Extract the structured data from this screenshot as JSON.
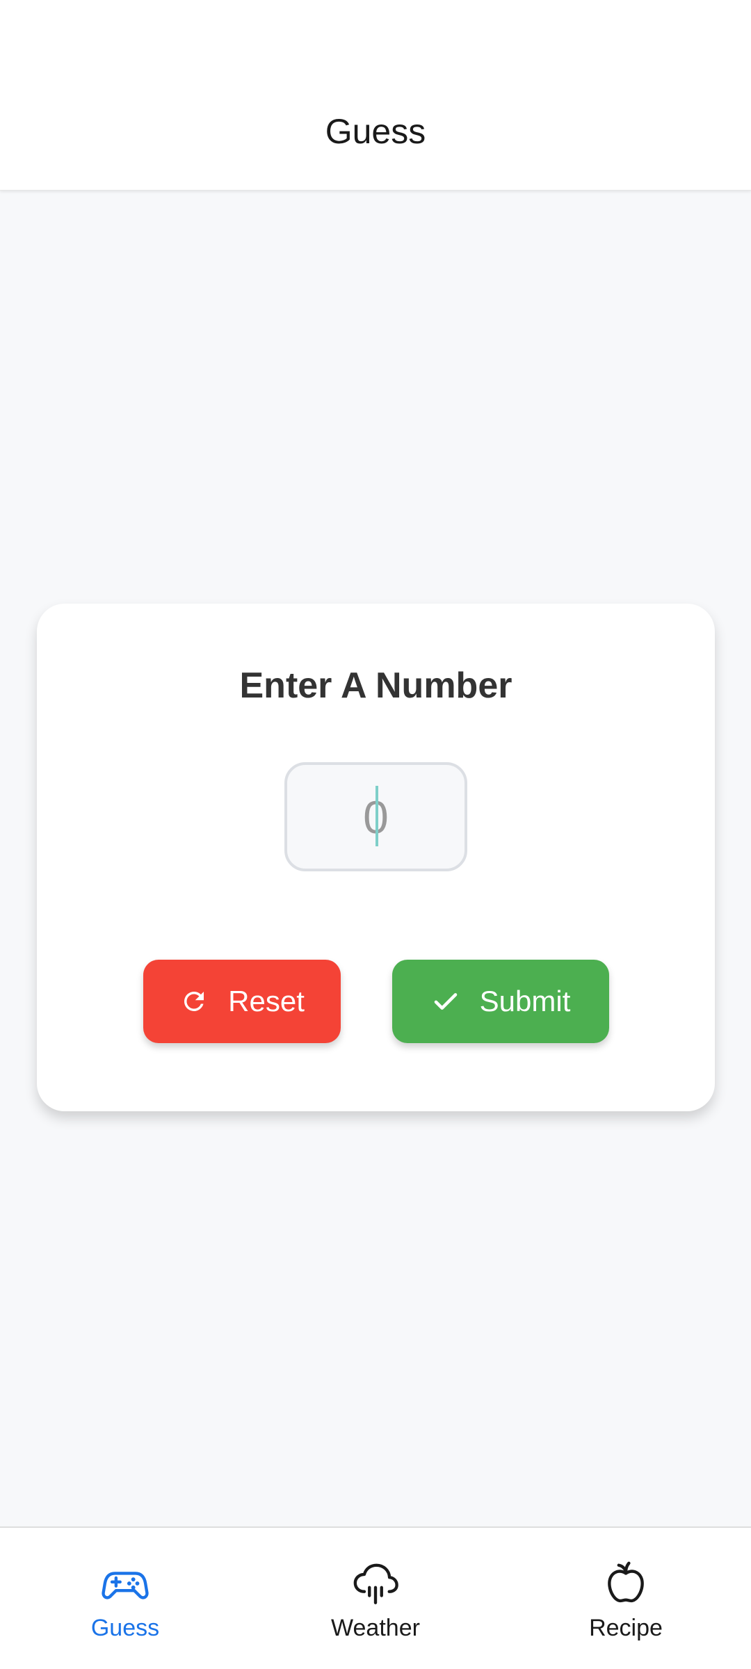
{
  "header": {
    "title": "Guess"
  },
  "card": {
    "title": "Enter A Number",
    "input": {
      "value": "",
      "placeholder": "0"
    },
    "reset_label": "Reset",
    "submit_label": "Submit"
  },
  "colors": {
    "reset": "#f44336",
    "submit": "#4caf50",
    "active_tab": "#1a73e8",
    "inactive_tab": "#1a1a1a"
  },
  "bottom_nav": {
    "items": [
      {
        "label": "Guess",
        "icon": "gamepad-icon",
        "active": true
      },
      {
        "label": "Weather",
        "icon": "rain-cloud-icon",
        "active": false
      },
      {
        "label": "Recipe",
        "icon": "apple-icon",
        "active": false
      }
    ]
  }
}
